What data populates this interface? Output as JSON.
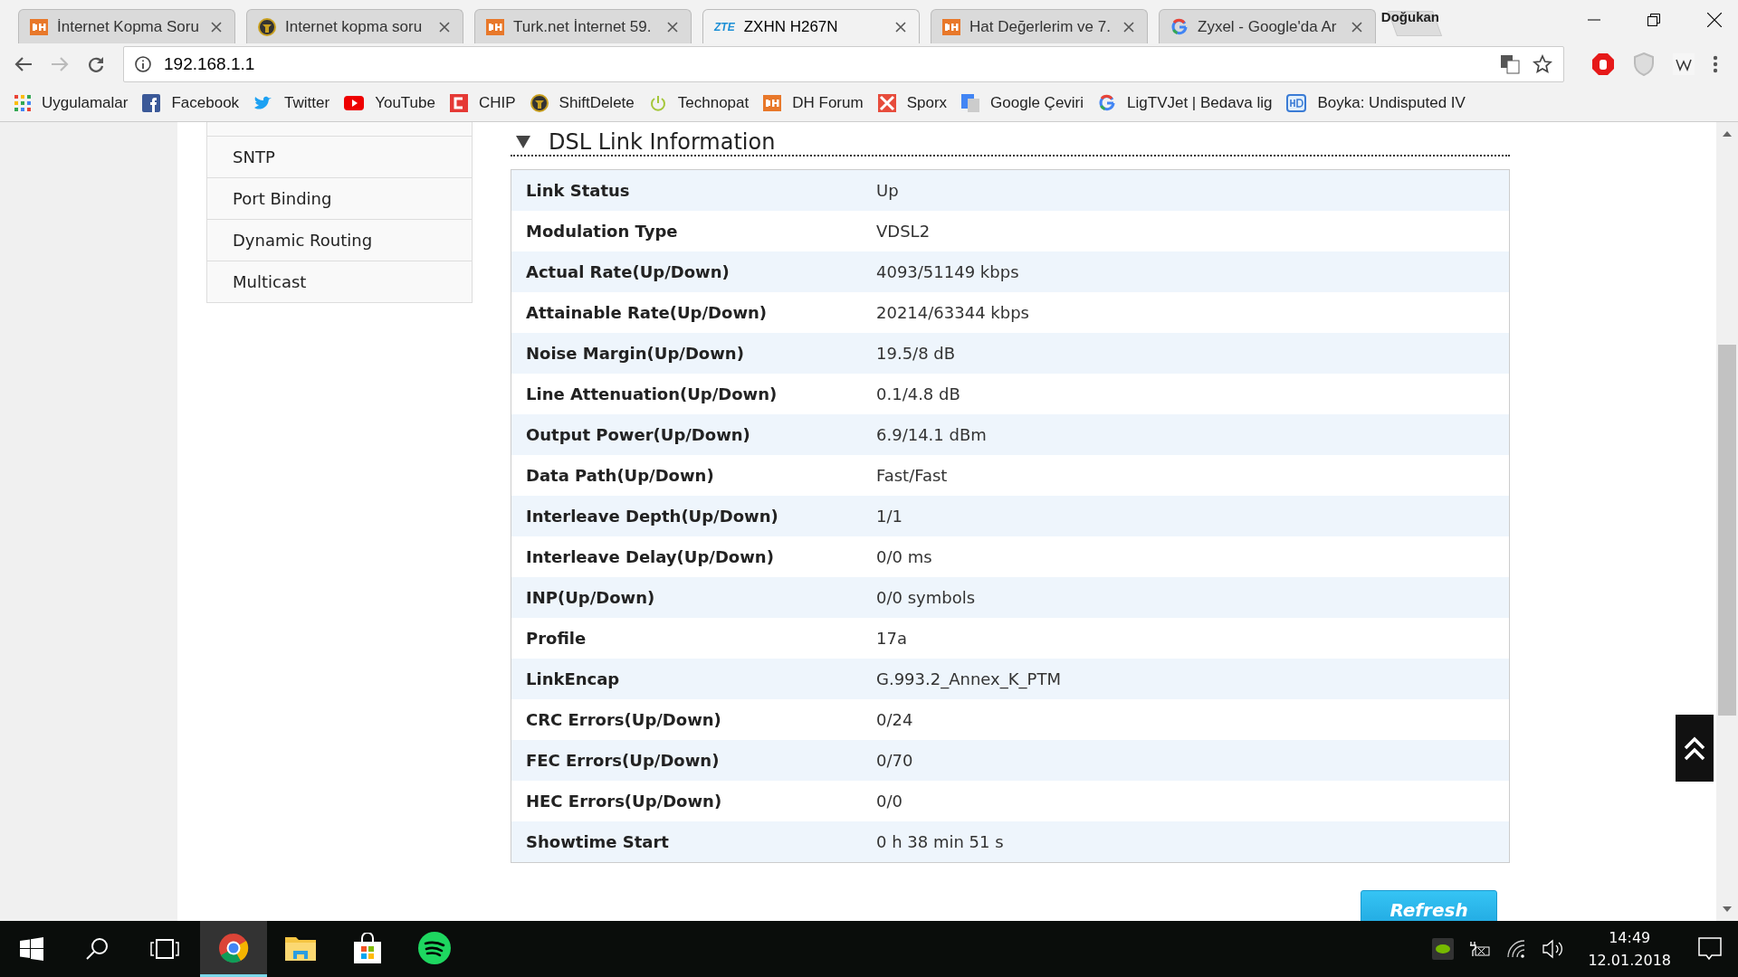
{
  "tabs": [
    {
      "title": "İnternet Kopma Soru",
      "selected": false
    },
    {
      "title": "Internet kopma soru",
      "selected": false
    },
    {
      "title": "Turk.net İnternet 59.",
      "selected": false
    },
    {
      "title": "ZXHN H267N",
      "logo_text": "ZTE",
      "selected": true
    },
    {
      "title": "Hat Değerlerim ve 7.",
      "selected": false
    },
    {
      "title": "Zyxel - Google'da Ar",
      "selected": false
    }
  ],
  "profile": "Doğukan",
  "address": "192.168.1.1",
  "bookmarks": [
    {
      "label": "Uygulamalar"
    },
    {
      "label": "Facebook"
    },
    {
      "label": "Twitter"
    },
    {
      "label": "YouTube"
    },
    {
      "label": "CHIP"
    },
    {
      "label": "ShiftDelete"
    },
    {
      "label": "Technopat"
    },
    {
      "label": "DH Forum"
    },
    {
      "label": "Sporx"
    },
    {
      "label": "Google Çeviri"
    },
    {
      "label": "LigTVJet | Bedava lig"
    },
    {
      "label": "Boyka: Undisputed IV"
    }
  ],
  "sidebar": {
    "items": [
      {
        "label": "SNTP"
      },
      {
        "label": "Port Binding"
      },
      {
        "label": "Dynamic Routing"
      },
      {
        "label": "Multicast"
      }
    ]
  },
  "section": {
    "title": "DSL Link Information",
    "expanded": true
  },
  "table": {
    "rows": [
      {
        "label": "Link Status",
        "value": "Up"
      },
      {
        "label": "Modulation Type",
        "value": "VDSL2"
      },
      {
        "label": "Actual Rate(Up/Down)",
        "value": "4093/51149 kbps"
      },
      {
        "label": "Attainable Rate(Up/Down)",
        "value": "20214/63344 kbps"
      },
      {
        "label": "Noise Margin(Up/Down)",
        "value": "19.5/8 dB"
      },
      {
        "label": "Line Attenuation(Up/Down)",
        "value": "0.1/4.8 dB"
      },
      {
        "label": "Output Power(Up/Down)",
        "value": "6.9/14.1 dBm"
      },
      {
        "label": "Data Path(Up/Down)",
        "value": "Fast/Fast"
      },
      {
        "label": "Interleave Depth(Up/Down)",
        "value": "1/1"
      },
      {
        "label": "Interleave Delay(Up/Down)",
        "value": "0/0 ms"
      },
      {
        "label": "INP(Up/Down)",
        "value": "0/0 symbols"
      },
      {
        "label": "Profile",
        "value": "17a"
      },
      {
        "label": "LinkEncap",
        "value": "G.993.2_Annex_K_PTM"
      },
      {
        "label": "CRC Errors(Up/Down)",
        "value": "0/24"
      },
      {
        "label": "FEC Errors(Up/Down)",
        "value": "0/70"
      },
      {
        "label": "HEC Errors(Up/Down)",
        "value": "0/0"
      },
      {
        "label": "Showtime Start",
        "value": "0 h 38 min 51 s"
      }
    ]
  },
  "refresh_button": "Refresh",
  "taskbar": {
    "apps": [
      {
        "selected": true
      },
      {
        "selected": false
      },
      {
        "selected": false
      },
      {
        "selected": false
      }
    ],
    "time": "14:49",
    "date": "12.01.2018"
  }
}
